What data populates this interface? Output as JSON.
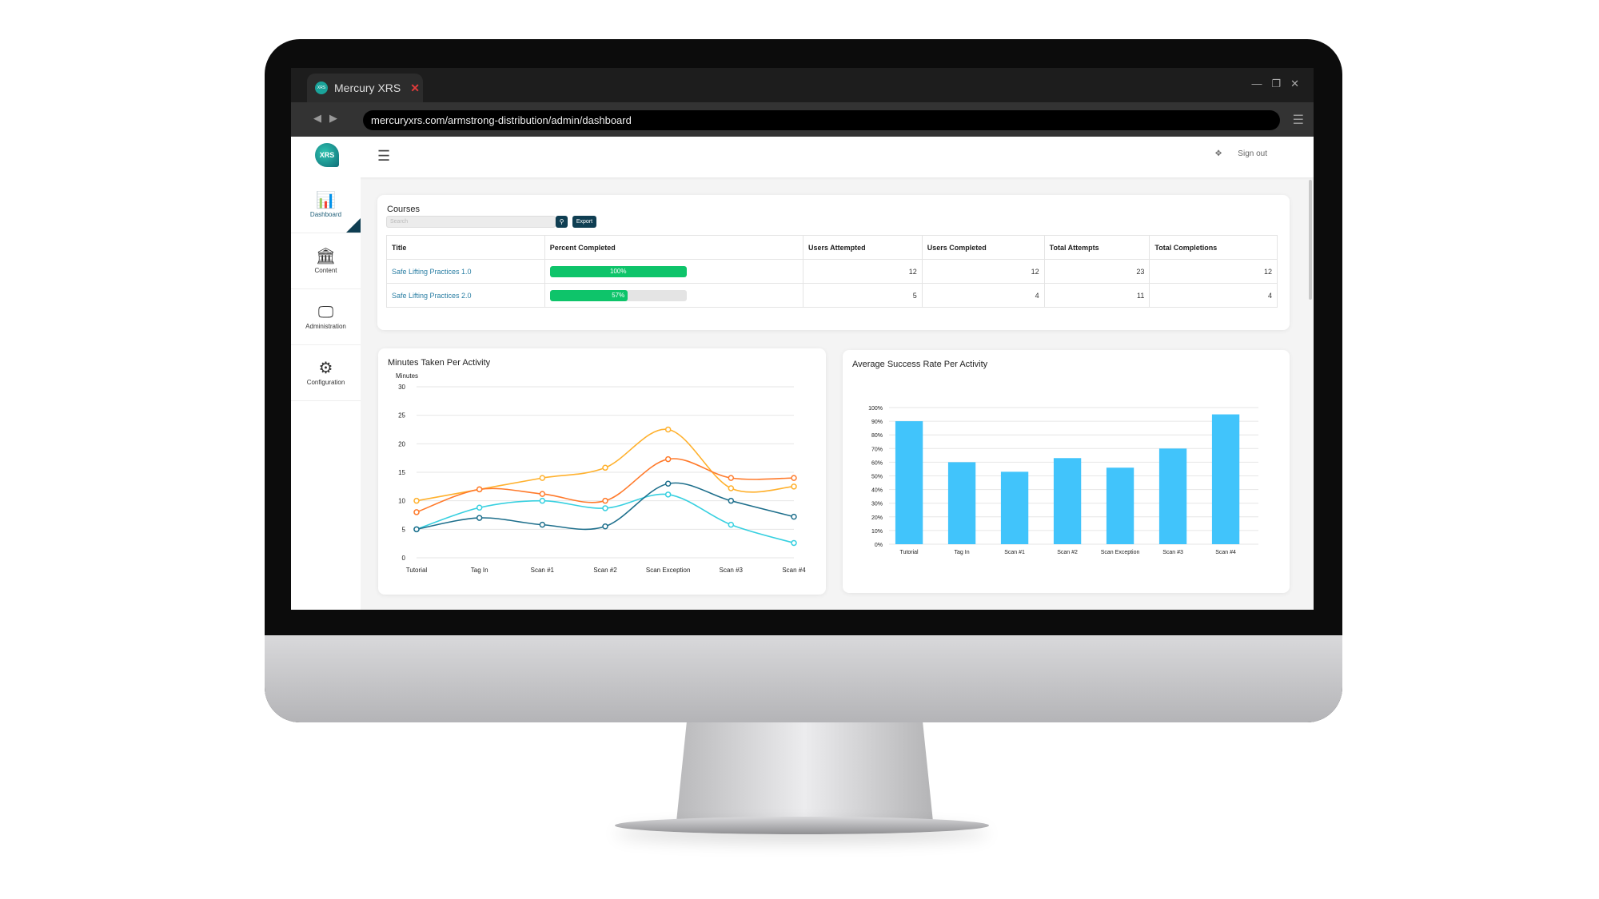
{
  "browser": {
    "tab_title": "Mercury XRS",
    "tab_close": "✕",
    "favicon": "XRS",
    "url": "mercuryxrs.com/armstrong-distribution/admin/dashboard",
    "window_controls": [
      "—",
      "❐",
      "✕"
    ]
  },
  "header": {
    "logo": "XRS",
    "sign_out": "Sign out",
    "fullscreen_icon": "move-arrows-icon"
  },
  "sidebar": {
    "items": [
      {
        "label": "Dashboard",
        "icon": "chart-icon",
        "active": true
      },
      {
        "label": "Content",
        "icon": "bank-icon"
      },
      {
        "label": "Administration",
        "icon": "monitor-user-icon"
      },
      {
        "label": "Configuration",
        "icon": "gears-icon"
      }
    ]
  },
  "courses": {
    "title": "Courses",
    "search_placeholder": "Search",
    "export_label": "Export",
    "columns": [
      "Title",
      "Percent Completed",
      "Users Attempted",
      "Users Completed",
      "Total Attempts",
      "Total Completions"
    ],
    "rows": [
      {
        "title": "Safe Lifting Practices 1.0",
        "percent": 100,
        "percent_label": "100%",
        "attempted": "12",
        "completed": "12",
        "total_attempts": "23",
        "total_completions": "12"
      },
      {
        "title": "Safe Lifting Practices 2.0",
        "percent": 57,
        "percent_label": "57%",
        "attempted": "5",
        "completed": "4",
        "total_attempts": "11",
        "total_completions": "4"
      }
    ],
    "progress_color": "#0ec46a"
  },
  "chart_data": [
    {
      "type": "line",
      "title": "Minutes Taken Per Activity",
      "ylabel": "Minutes",
      "xlabel": "",
      "ylim": [
        0,
        30
      ],
      "yticks": [
        0,
        5,
        10,
        15,
        20,
        25,
        30
      ],
      "grid": true,
      "categories": [
        "Tutorial",
        "Tag In",
        "Scan #1",
        "Scan #2",
        "Scan Exception",
        "Scan #3",
        "Scan #4"
      ],
      "series": [
        {
          "color": "#ffb12e",
          "values": [
            10,
            12,
            14,
            15.8,
            22.5,
            12.2,
            12.5
          ]
        },
        {
          "color": "#ff7a2b",
          "values": [
            8,
            12,
            11.2,
            10,
            17.3,
            14,
            14
          ]
        },
        {
          "color": "#37d0e0",
          "values": [
            5,
            8.8,
            10,
            8.7,
            11.1,
            5.8,
            2.6
          ]
        },
        {
          "color": "#1e6f8c",
          "values": [
            5,
            7,
            5.8,
            5.5,
            13,
            10,
            7.2
          ]
        }
      ]
    },
    {
      "type": "bar",
      "title": "Average Success Rate Per Activity",
      "ylim": [
        0,
        100
      ],
      "yticks": [
        "0%",
        "10%",
        "20%",
        "30%",
        "40%",
        "50%",
        "60%",
        "70%",
        "80%",
        "90%",
        "100%"
      ],
      "grid": true,
      "categories": [
        "Tutorial",
        "Tag In",
        "Scan #1",
        "Scan #2",
        "Scan Exception",
        "Scan #3",
        "Scan #4"
      ],
      "values": [
        90,
        60,
        53,
        63,
        56,
        70,
        95
      ],
      "color": "#41c4fb"
    }
  ]
}
